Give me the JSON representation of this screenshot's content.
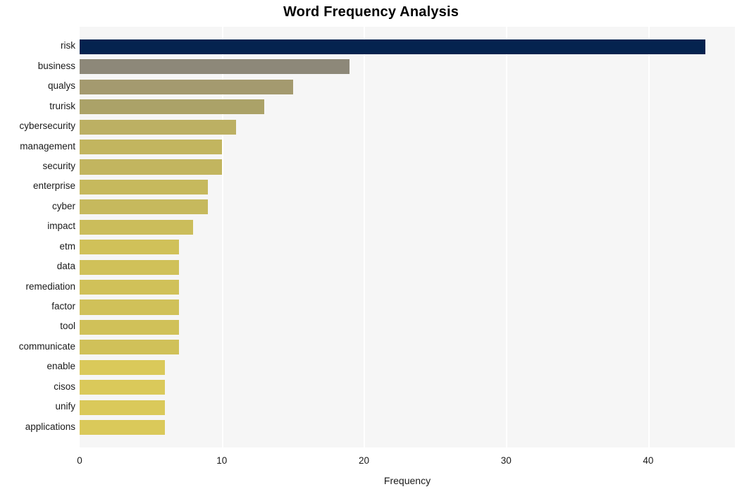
{
  "chart_data": {
    "type": "bar",
    "orientation": "horizontal",
    "title": "Word Frequency Analysis",
    "xlabel": "Frequency",
    "ylabel": "",
    "xlim": [
      0,
      46.1
    ],
    "xticks": [
      0,
      10,
      20,
      30,
      40
    ],
    "xtick_labels": [
      "0",
      "10",
      "20",
      "30",
      "40"
    ],
    "grid": "vertical-white",
    "legend": "none",
    "plot_background": "#f6f6f6",
    "figure_background": "#ffffff",
    "categories": [
      "risk",
      "business",
      "qualys",
      "trurisk",
      "cybersecurity",
      "management",
      "security",
      "enterprise",
      "cyber",
      "impact",
      "etm",
      "data",
      "remediation",
      "factor",
      "tool",
      "communicate",
      "enable",
      "cisos",
      "unify",
      "applications"
    ],
    "values": [
      44,
      19,
      15,
      13,
      11,
      10,
      10,
      9,
      9,
      8,
      7,
      7,
      7,
      7,
      7,
      7,
      6,
      6,
      6,
      6
    ],
    "bar_colors": [
      "#05234f",
      "#8d8879",
      "#a49a6f",
      "#aba268",
      "#bcb063",
      "#c2b55f",
      "#c2b55f",
      "#c6b95d",
      "#c6b95d",
      "#cbbd5b",
      "#d0c159",
      "#d0c159",
      "#d0c159",
      "#d0c159",
      "#d0c159",
      "#d0c159",
      "#dac95a",
      "#dac95a",
      "#dac95a",
      "#dac95a"
    ]
  }
}
